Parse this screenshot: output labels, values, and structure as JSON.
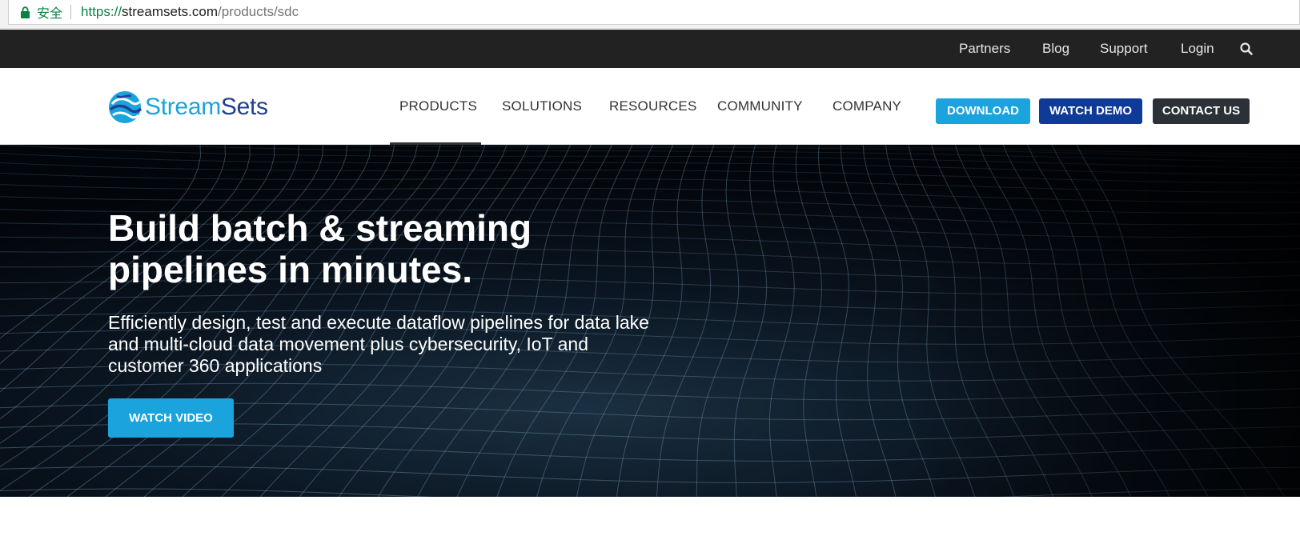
{
  "browser": {
    "secure_label": "安全",
    "url_scheme": "https://",
    "url_host": "streamsets.com",
    "url_path": "/products/sdc"
  },
  "utility_nav": {
    "items": [
      "Partners",
      "Blog",
      "Support",
      "Login"
    ],
    "search_icon": "search-icon"
  },
  "brand": {
    "name_part1": "Stream",
    "name_part2": "Sets",
    "color_light": "#1aa3dd",
    "color_dark": "#1f3f8f"
  },
  "main_nav": {
    "items": [
      "PRODUCTS",
      "SOLUTIONS",
      "RESOURCES",
      "COMMUNITY",
      "COMPANY"
    ],
    "active": "PRODUCTS"
  },
  "header_buttons": {
    "download": "DOWNLOAD",
    "watch_demo": "WATCH DEMO",
    "contact_us": "CONTACT US"
  },
  "hero": {
    "title_line1": "Build batch & streaming",
    "title_line2": "pipelines in minutes.",
    "subtitle": "Efficiently design, test and execute dataflow pipelines for data lake and multi-cloud data movement plus cybersecurity, IoT and customer 360 applications",
    "cta": "WATCH VIDEO"
  },
  "colors": {
    "accent": "#1aa3dd",
    "navy": "#0e3a98",
    "dark_button": "#2b3137",
    "utility_bar": "#222222"
  }
}
